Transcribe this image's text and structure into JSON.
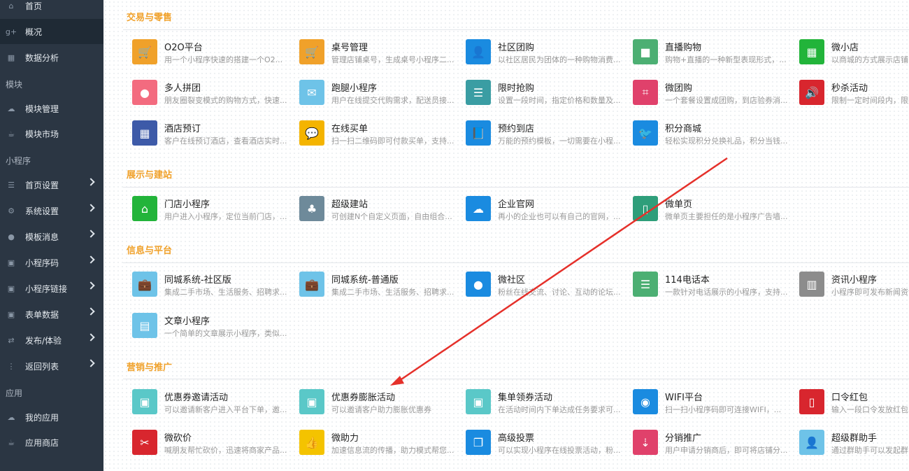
{
  "sidebar": {
    "items": [
      {
        "label": "首页",
        "icon": "home-icon",
        "glyph": "⌂"
      },
      {
        "label": "概况",
        "icon": "google-plus-icon",
        "glyph": "g+"
      },
      {
        "label": "数据分析",
        "icon": "chart-icon",
        "glyph": "▦"
      },
      {
        "label": "模块管理",
        "icon": "cloud-icon",
        "glyph": "☁"
      },
      {
        "label": "模块市场",
        "icon": "coffee-icon",
        "glyph": "☕"
      },
      {
        "label": "首页设置",
        "icon": "list-icon",
        "glyph": "☰"
      },
      {
        "label": "系统设置",
        "icon": "cogs-icon",
        "glyph": "⚙"
      },
      {
        "label": "模板消息",
        "icon": "comment-icon",
        "glyph": "●"
      },
      {
        "label": "小程序码",
        "icon": "qrcode-icon",
        "glyph": "▣"
      },
      {
        "label": "小程序链接",
        "icon": "qrcode-icon",
        "glyph": "▣"
      },
      {
        "label": "表单数据",
        "icon": "qrcode-icon",
        "glyph": "▣"
      },
      {
        "label": "发布/体验",
        "icon": "retweet-icon",
        "glyph": "⇄"
      },
      {
        "label": "返回列表",
        "icon": "ellipsis-vertical-icon",
        "glyph": "⋮"
      },
      {
        "label": "我的应用",
        "icon": "cloud-icon",
        "glyph": "☁"
      },
      {
        "label": "应用商店",
        "icon": "coffee-icon",
        "glyph": "☕"
      }
    ],
    "sections": [
      "模块",
      "小程序",
      "应用"
    ]
  },
  "sections": [
    {
      "title": "交易与零售",
      "cards": [
        {
          "title": "O2O平台",
          "desc": "用一个小程序快速的搭建一个O2...",
          "color": "#f0a12a",
          "icon": "cart-icon",
          "glyph": "🛒"
        },
        {
          "title": "桌号管理",
          "desc": "管理店铺桌号，生成桌号小程序二...",
          "color": "#f0a12a",
          "icon": "cart-icon",
          "glyph": "🛒"
        },
        {
          "title": "社区团购",
          "desc": "以社区居民为团体的一种购物消费...",
          "color": "#1a8be0",
          "icon": "user-tie-icon",
          "glyph": "👤"
        },
        {
          "title": "直播购物",
          "desc": "购物+直播的一种新型表现形式，...",
          "color": "#4caf73",
          "icon": "video-camera-icon",
          "glyph": "■"
        },
        {
          "title": "微小店",
          "desc": "以商城的方式展示店铺，",
          "color": "#22b43a",
          "icon": "grid-icon",
          "glyph": "▦"
        },
        {
          "title": "多人拼团",
          "desc": "朋友圈裂变模式的购物方式，快速...",
          "color": "#f36b7f",
          "icon": "users-icon",
          "glyph": "●"
        },
        {
          "title": "跑腿小程序",
          "desc": "用户在线提交代购需求，配送员接...",
          "color": "#6ec3e8",
          "icon": "envelope-icon",
          "glyph": "✉"
        },
        {
          "title": "限时抢购",
          "desc": "设置一段时间，指定价格和数量及...",
          "color": "#3a9da3",
          "icon": "server-icon",
          "glyph": "☰"
        },
        {
          "title": "微团购",
          "desc": "一个套餐设置成团购，到店验券消...",
          "color": "#e0416b",
          "icon": "crop-icon",
          "glyph": "⌗"
        },
        {
          "title": "秒杀活动",
          "desc": "限制一定时间段内，限购",
          "color": "#d8262e",
          "icon": "volume-icon",
          "glyph": "🔊"
        },
        {
          "title": "酒店预订",
          "desc": "客户在线预订酒店，查看酒店实时...",
          "color": "#3d5aa8",
          "icon": "table-icon",
          "glyph": "▦"
        },
        {
          "title": "在线买单",
          "desc": "扫一扫二维码即可付款买单，支持...",
          "color": "#f4b400",
          "icon": "comment-icon",
          "glyph": "💬"
        },
        {
          "title": "预约到店",
          "desc": "万能的预约模板，一切需要在小程...",
          "color": "#1a8be0",
          "icon": "book-icon",
          "glyph": "📘"
        },
        {
          "title": "积分商城",
          "desc": "轻松实现积分兑换礼品，积分当钱...",
          "color": "#1a8be0",
          "icon": "twitter-icon",
          "glyph": "🐦"
        }
      ]
    },
    {
      "title": "展示与建站",
      "cards": [
        {
          "title": "门店小程序",
          "desc": "用户进入小程序，定位当前门店，...",
          "color": "#22b43a",
          "icon": "home-icon",
          "glyph": "⌂"
        },
        {
          "title": "超级建站",
          "desc": "可创建N个自定义页面，自由组合...",
          "color": "#6e8a9a",
          "icon": "sitemap-icon",
          "glyph": "♣"
        },
        {
          "title": "企业官网",
          "desc": "再小的企业也可以有自己的官网，...",
          "color": "#1a8be0",
          "icon": "cloud-icon",
          "glyph": "☁"
        },
        {
          "title": "微单页",
          "desc": "微单页主要担任的是小程序广告墙...",
          "color": "#2e9e7a",
          "icon": "mobile-icon",
          "glyph": "▯"
        }
      ]
    },
    {
      "title": "信息与平台",
      "cards": [
        {
          "title": "同城系统-社区版",
          "desc": "集成二手市场、生活服务、招聘求...",
          "color": "#6ec3e8",
          "icon": "briefcase-icon",
          "glyph": "💼"
        },
        {
          "title": "同城系统-普通版",
          "desc": "集成二手市场、生活服务、招聘求...",
          "color": "#6ec3e8",
          "icon": "briefcase-icon",
          "glyph": "💼"
        },
        {
          "title": "微社区",
          "desc": "粉丝在线交流、讨论、互动的论坛...",
          "color": "#1a8be0",
          "icon": "users-icon",
          "glyph": "●"
        },
        {
          "title": "114电话本",
          "desc": "一款针对电话展示的小程序，支持...",
          "color": "#4caf73",
          "icon": "list-icon",
          "glyph": "☰"
        },
        {
          "title": "资讯小程序",
          "desc": "小程序即可发布新闻资讯",
          "color": "#8c8c8c",
          "icon": "building-icon",
          "glyph": "▥"
        },
        {
          "title": "文章小程序",
          "desc": "一个简单的文章展示小程序，类似...",
          "color": "#6ec3e8",
          "icon": "file-text-icon",
          "glyph": "▤"
        }
      ]
    },
    {
      "title": "营销与推广",
      "cards": [
        {
          "title": "优惠券邀请活动",
          "desc": "可以邀请新客户进入平台下单，邀...",
          "color": "#5ac8c8",
          "icon": "qrcode-icon",
          "glyph": "▣"
        },
        {
          "title": "优惠券膨胀活动",
          "desc": "可以邀请客户助力膨胀优惠券",
          "color": "#5ac8c8",
          "icon": "qrcode-icon",
          "glyph": "▣"
        },
        {
          "title": "集单领券活动",
          "desc": "在活动时间内下单达成任务要求可...",
          "color": "#5ac8c8",
          "icon": "qrcode-icon",
          "glyph": "▣"
        },
        {
          "title": "WIFI平台",
          "desc": "扫一扫小程序码即可连接WIFI，...",
          "color": "#1a8be0",
          "icon": "rss-icon",
          "glyph": "◉"
        },
        {
          "title": "口令红包",
          "desc": "输入一段口令发放红包",
          "color": "#d8262e",
          "icon": "file-icon",
          "glyph": "▯"
        },
        {
          "title": "微砍价",
          "desc": "喊朋友帮忙砍价，迅速将商家产品...",
          "color": "#d8262e",
          "icon": "scissors-icon",
          "glyph": "✂"
        },
        {
          "title": "微助力",
          "desc": "加速信息流的传播，助力模式帮您...",
          "color": "#f4c300",
          "icon": "thumbs-up-icon",
          "glyph": "👍"
        },
        {
          "title": "高级投票",
          "desc": "可以实现小程序在线投票活动，粉...",
          "color": "#1a8be0",
          "icon": "copy-icon",
          "glyph": "❐"
        },
        {
          "title": "分销推广",
          "desc": "用户申请分销商后，即可将店铺分...",
          "color": "#e0416b",
          "icon": "sort-amount-icon",
          "glyph": "⇣"
        },
        {
          "title": "超级群助手",
          "desc": "通过群助手可以发起群",
          "color": "#6ec3e8",
          "icon": "user-tie-icon",
          "glyph": "👤"
        }
      ]
    }
  ]
}
